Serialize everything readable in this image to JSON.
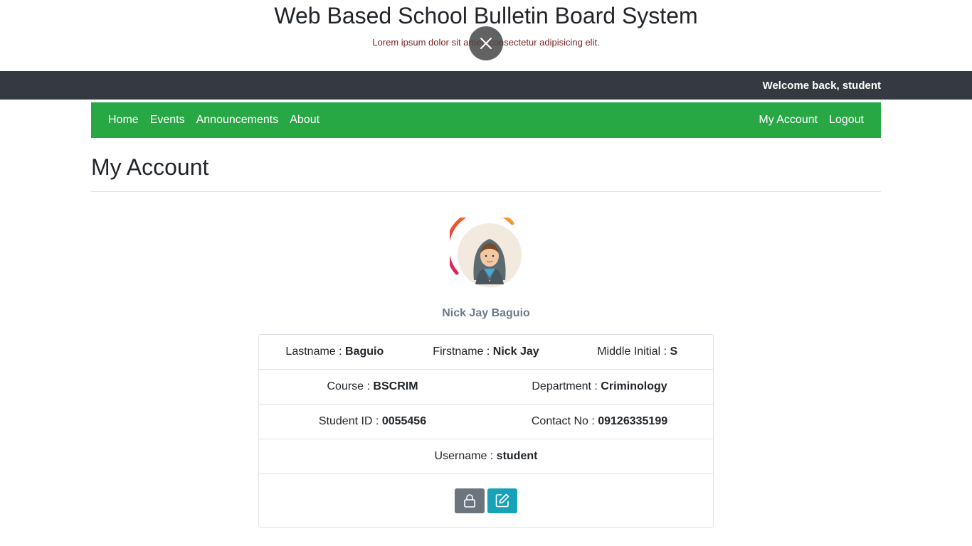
{
  "header": {
    "title": "Web Based School Bulletin Board System",
    "tagline": "Lorem ipsum dolor sit amet, consectetur adipisicing elit."
  },
  "overlay": {
    "icon": "close-icon"
  },
  "topbar": {
    "welcome": "Welcome back, student"
  },
  "nav": {
    "left": [
      "Home",
      "Events",
      "Announcements",
      "About"
    ],
    "right": [
      "My Account",
      "Logout"
    ]
  },
  "page": {
    "title": "My Account"
  },
  "profile": {
    "avatar_icon": "avatar-hooded-user-icon",
    "name": "Nick Jay Baguio"
  },
  "info": {
    "lastname_label": "Lastname : ",
    "lastname": "Baguio",
    "firstname_label": "Firstname : ",
    "firstname": "Nick Jay",
    "middle_label": "Middle Initial : ",
    "middle": "S",
    "course_label": "Course : ",
    "course": "BSCRIM",
    "department_label": "Department : ",
    "department": "Criminology",
    "studentid_label": "Student ID : ",
    "studentid": "0055456",
    "contact_label": "Contact No : ",
    "contact": "09126335199",
    "username_label": "Username : ",
    "username": "student"
  },
  "actions": {
    "change_password_icon": "lock-icon",
    "edit_icon": "edit-icon"
  },
  "colors": {
    "nav_green": "#28a745",
    "topbar_dark": "#343a40",
    "btn_secondary": "#6c757d",
    "btn_info": "#17a2b8"
  }
}
